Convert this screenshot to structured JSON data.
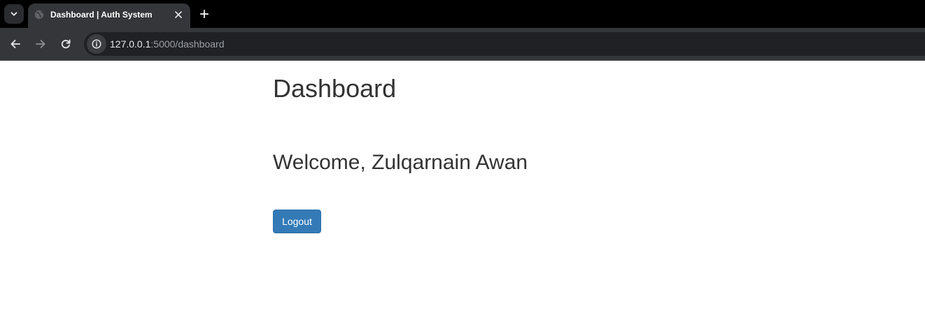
{
  "browser": {
    "tab": {
      "title": "Dashboard | Auth System",
      "favicon": "globe-icon"
    },
    "url": {
      "host": "127.0.0.1",
      "path": ":5000/dashboard"
    },
    "icons": {
      "tab_search": "chevron-down-icon",
      "close": "close-icon",
      "new_tab": "plus-icon",
      "back": "arrow-left-icon",
      "forward": "arrow-right-icon",
      "reload": "reload-icon",
      "site_info": "info-icon"
    },
    "colors": {
      "tabstrip": "#000000",
      "toolbar": "#35363a",
      "omnibox": "#202124"
    }
  },
  "page": {
    "title": "Dashboard",
    "welcome_text": "Welcome, Zulqarnain Awan",
    "logout_label": "Logout",
    "colors": {
      "text": "#333333",
      "button": "#337ab7"
    }
  }
}
